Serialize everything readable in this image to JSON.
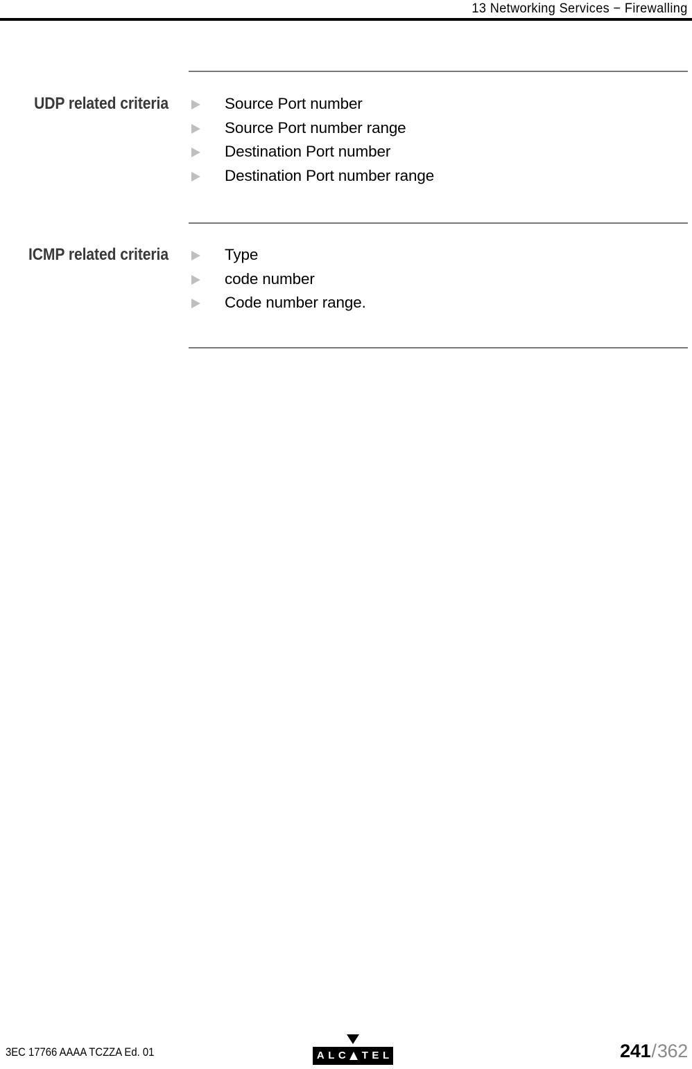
{
  "header": {
    "running_head": "13 Networking Services − Firewalling"
  },
  "sections": [
    {
      "heading": "UDP related criteria",
      "items": [
        "Source Port number",
        "Source Port number range",
        "Destination Port number",
        "Destination Port number range"
      ]
    },
    {
      "heading": "ICMP related criteria",
      "items": [
        "Type",
        "code number",
        "Code number range."
      ]
    }
  ],
  "footer": {
    "doc_id": "3EC 17766 AAAA TCZZA Ed. 01",
    "logo": {
      "name": "ALCATEL",
      "letters": [
        "A",
        "L",
        "C",
        "T",
        "E",
        "L"
      ]
    },
    "page_current": "241",
    "page_separator": "/",
    "page_total": "362"
  },
  "colors": {
    "heading": "#39393b",
    "rule": "#77777a",
    "bullet": "#bfbfbf",
    "page_total": "#8a8a8a",
    "text": "#000000"
  }
}
